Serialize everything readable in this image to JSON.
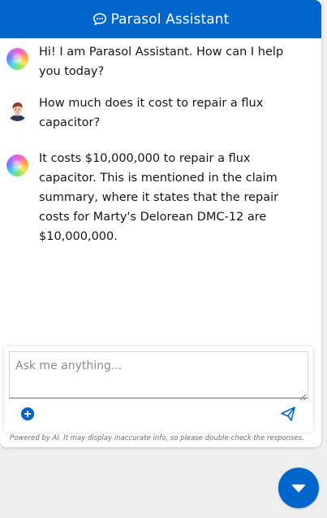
{
  "header": {
    "title": "Parasol Assistant",
    "icon": "chat-bubble-icon",
    "background": "#0066cc"
  },
  "messages": [
    {
      "role": "assistant",
      "avatar": "bot-avatar",
      "text": "Hi! I am Parasol Assistant. How can I help you today?"
    },
    {
      "role": "user",
      "avatar": "user-avatar",
      "text": "How much does it cost to repair a flux capacitor?"
    },
    {
      "role": "assistant",
      "avatar": "bot-avatar",
      "text": "It costs $10,000,000 to repair a flux capacitor. This is mentioned in the claim summary, where it states that the repair costs for Marty's Delorean DMC-12 are $10,000,000."
    }
  ],
  "composer": {
    "placeholder": "Ask me anything...",
    "value": "",
    "attach_icon": "plus-circle-icon",
    "send_icon": "paper-plane-icon"
  },
  "disclaimer": "Powered by AI. It may display inaccurate info, so please double-check the responses.",
  "scroll_button": {
    "icon": "chevron-down-icon"
  },
  "colors": {
    "accent": "#0066cc",
    "page_bg": "#efefef",
    "text": "#151515"
  }
}
